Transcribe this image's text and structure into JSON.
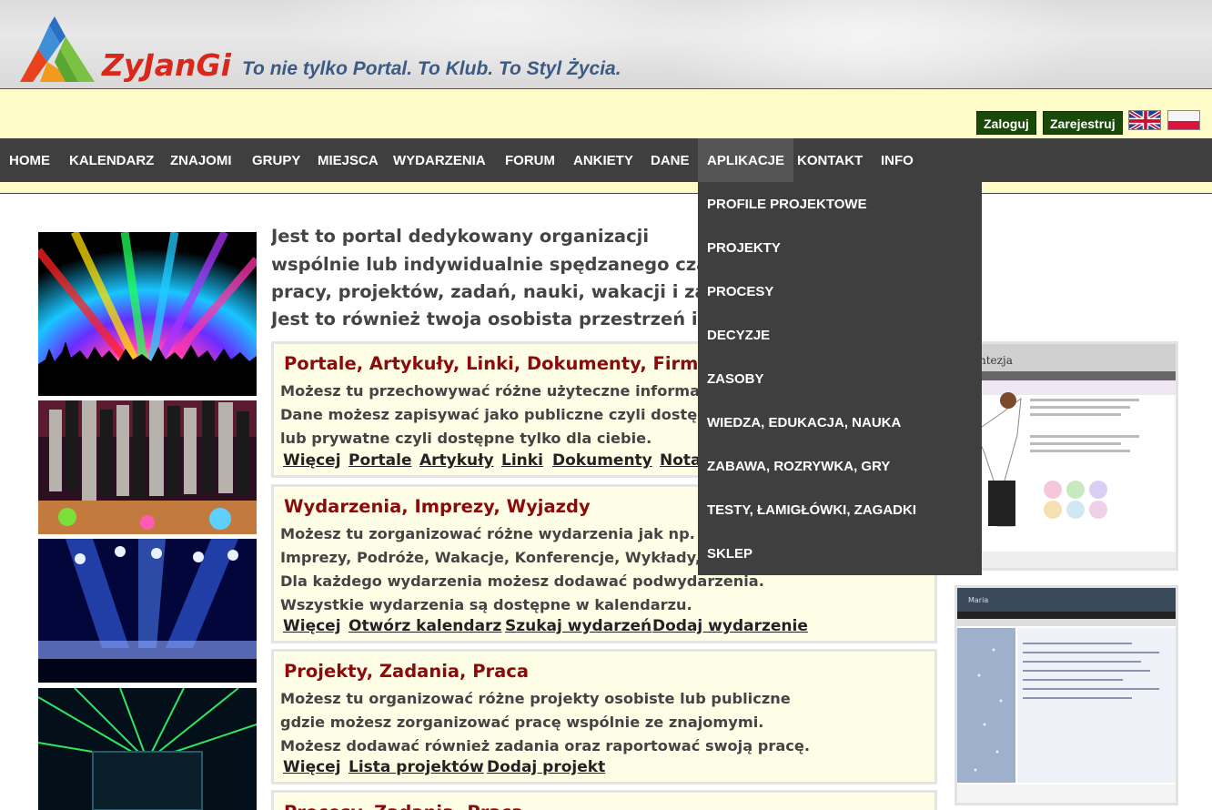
{
  "header": {
    "brand": "ZyJanGi",
    "slogan": "To nie tylko Portal. To Klub. To Styl Życia."
  },
  "auth": {
    "login_label": "Zaloguj",
    "register_label": "Zarejestruj"
  },
  "nav": {
    "items": [
      "HOME",
      "KALENDARZ",
      "ZNAJOMI",
      "GRUPY",
      "MIEJSCA",
      "WYDARZENIA",
      "FORUM",
      "ANKIETY",
      "DANE",
      "APLIKACJE",
      "KONTAKT",
      "INFO"
    ],
    "active": "APLIKACJE"
  },
  "dropdown": {
    "items": [
      "PROFILE PROJEKTOWE",
      "PROJEKTY",
      "PROCESY",
      "DECYZJE",
      "ZASOBY",
      "WIEDZA, EDUKACJA, NAUKA",
      "ZABAWA, ROZRYWKA, GRY",
      "TESTY, ŁAMIGŁÓWKI, ZAGADKI",
      "SKLEP"
    ]
  },
  "intro": {
    "lines": [
      "Jest to portal dedykowany organizacji",
      "wspólnie lub indywidualnie spędzanego czasu",
      "pracy, projektów, zadań, nauki, wakacji i zaba",
      "Jest to również twoja osobista przestrzeń i ba"
    ]
  },
  "boxes": [
    {
      "title": "Portale, Artykuły, Linki, Dokumenty, Firmy",
      "lines": [
        "Możesz tu przechowywać różne użyteczne informac",
        "Dane możesz zapisywać jako publiczne czyli dostęp",
        "lub prywatne czyli dostępne tylko dla ciebie."
      ],
      "links": [
        "Więcej",
        "Portale",
        "Artykuły",
        "Linki",
        "Dokumenty",
        "Nota"
      ]
    },
    {
      "title": "Wydarzenia, Imprezy, Wyjazdy",
      "lines": [
        "Możesz tu zorganizować różne wydarzenia jak np.",
        "Imprezy, Podróże, Wakacje, Konferencje, Wykłady,",
        "Dla każdego wydarzenia możesz dodawać podwydarzenia.",
        "Wszystkie wydarzenia są dostępne w kalendarzu."
      ],
      "links": [
        "Więcej",
        "Otwórz kalendarz",
        "Szukaj wydarzeń",
        "Dodaj wydarzenie"
      ]
    },
    {
      "title": "Projekty, Zadania, Praca",
      "lines": [
        "Możesz tu organizować różne projekty osobiste lub publiczne",
        "gdzie możesz zorganizować pracę wspólnie ze znajomymi.",
        "Możesz dodawać również zadania oraz raportować swoją pracę."
      ],
      "links": [
        "Więcej",
        "Lista projektów",
        "Dodaj projekt"
      ]
    },
    {
      "title": "Procesy, Zadania, Praca",
      "lines": [],
      "links": []
    }
  ],
  "shots": {
    "shot1_brand": "ntezja",
    "shot2_brand": "Maria"
  },
  "colors": {
    "nav_bg": "#3f3f3f",
    "cream": "#fdfbc8",
    "box_title": "#8b0a0a",
    "auth_bg": "#1a4a0a",
    "logo_red": "#d9271c"
  }
}
